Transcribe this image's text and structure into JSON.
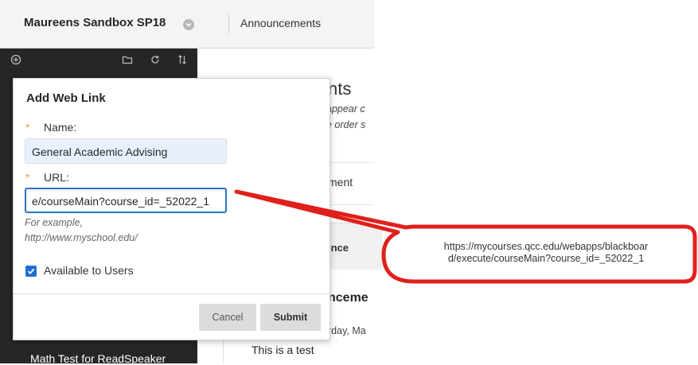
{
  "header": {
    "course_title": "Maureens Sandbox SP18",
    "breadcrumb": "Announcements"
  },
  "page": {
    "heading_fragment": "nts",
    "instruction_line1": "appear c",
    "instruction_line2": "e order s",
    "create_button_fragment": "ment",
    "tab_fragment": "ınce",
    "announcement_title_fragment": "nceme",
    "announcement_date_fragment": "rday, Ma",
    "announcement_body": "This is a test"
  },
  "left_menu": {
    "visible_item": "Math Test for ReadSpeaker"
  },
  "dialog": {
    "title": "Add Web Link",
    "name_label": "Name:",
    "name_value": "General Academic Advising",
    "url_label": "URL:",
    "url_value": "e/courseMain?course_id=_52022_1",
    "hint_line1": "For example,",
    "hint_line2": "http://www.myschool.edu/",
    "required_marker": "*",
    "available_label": "Available to Users",
    "available_checked": true,
    "cancel_label": "Cancel",
    "submit_label": "Submit"
  },
  "callout": {
    "line1": "https://mycourses.qcc.edu/webapps/blackboar",
    "line2": "d/execute/courseMain?course_id=_52022_1"
  },
  "colors": {
    "callout_border": "#e0201b",
    "accent_blue": "#1e6fd0",
    "required_orange": "#e89b4a",
    "nav_dark": "#262626"
  }
}
